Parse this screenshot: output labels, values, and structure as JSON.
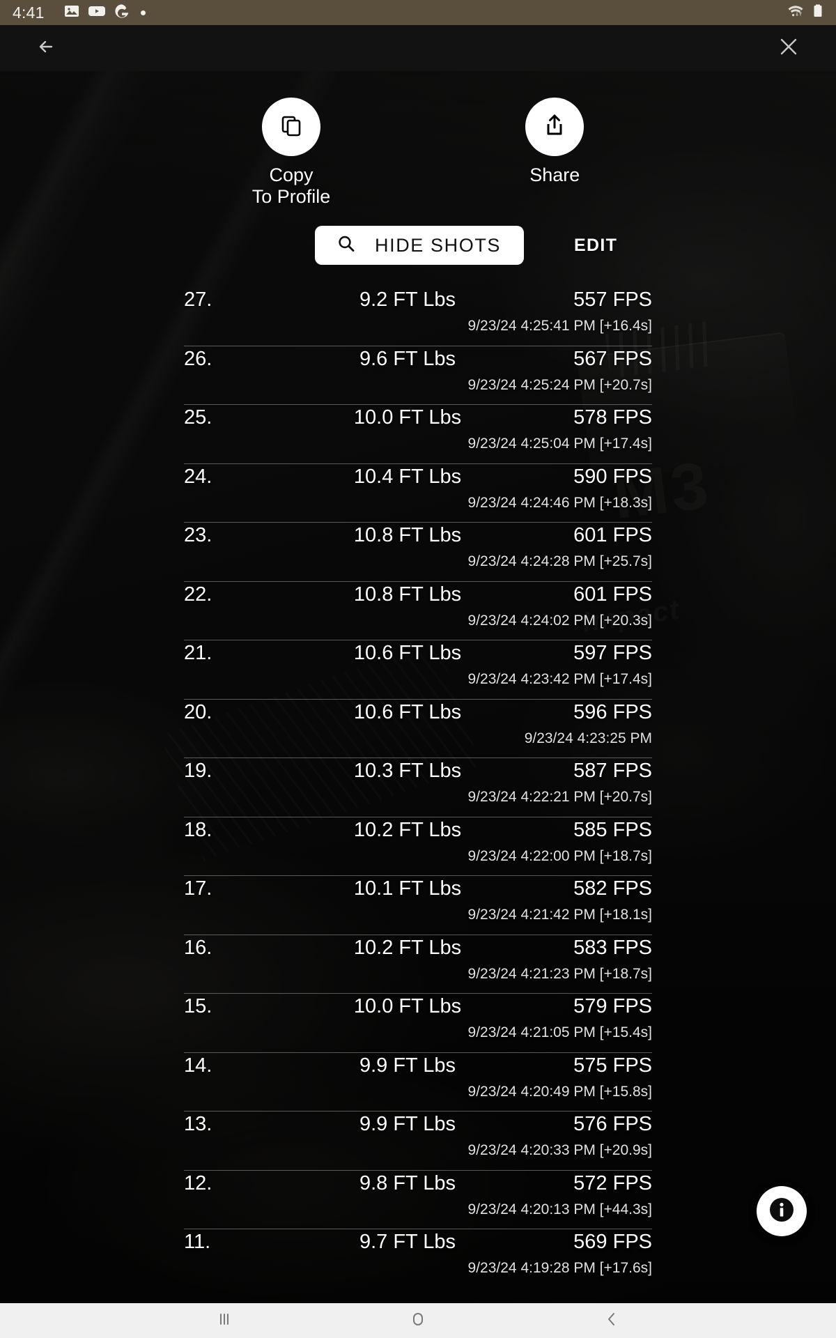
{
  "status_bar": {
    "time": "4:41",
    "icons": [
      "image-icon",
      "youtube-icon",
      "google-icon",
      "dot-icon"
    ],
    "right_icons": [
      "wifi-icon",
      "battery-icon"
    ]
  },
  "app_bar": {
    "back_icon": "arrow-left-icon",
    "close_icon": "close-icon"
  },
  "actions": [
    {
      "icon": "copy-icon",
      "label": "Copy\nTo Profile"
    },
    {
      "icon": "share-icon",
      "label": "Share"
    }
  ],
  "filter_row": {
    "search_icon": "search-icon",
    "hide_shots_label": "HIDE SHOTS",
    "edit_label": "EDIT"
  },
  "shots": [
    {
      "index": "27.",
      "energy": "9.2 FT Lbs",
      "speed": "557 FPS",
      "timestamp": "9/23/24 4:25:41 PM [+16.4s]"
    },
    {
      "index": "26.",
      "energy": "9.6 FT Lbs",
      "speed": "567 FPS",
      "timestamp": "9/23/24 4:25:24 PM [+20.7s]"
    },
    {
      "index": "25.",
      "energy": "10.0 FT Lbs",
      "speed": "578 FPS",
      "timestamp": "9/23/24 4:25:04 PM [+17.4s]"
    },
    {
      "index": "24.",
      "energy": "10.4 FT Lbs",
      "speed": "590 FPS",
      "timestamp": "9/23/24 4:24:46 PM [+18.3s]"
    },
    {
      "index": "23.",
      "energy": "10.8 FT Lbs",
      "speed": "601 FPS",
      "timestamp": "9/23/24 4:24:28 PM [+25.7s]"
    },
    {
      "index": "22.",
      "energy": "10.8 FT Lbs",
      "speed": "601 FPS",
      "timestamp": "9/23/24 4:24:02 PM [+20.3s]"
    },
    {
      "index": "21.",
      "energy": "10.6 FT Lbs",
      "speed": "597 FPS",
      "timestamp": "9/23/24 4:23:42 PM [+17.4s]"
    },
    {
      "index": "20.",
      "energy": "10.6 FT Lbs",
      "speed": "596 FPS",
      "timestamp": "9/23/24 4:23:25 PM"
    },
    {
      "index": "19.",
      "energy": "10.3 FT Lbs",
      "speed": "587 FPS",
      "timestamp": "9/23/24 4:22:21 PM [+20.7s]"
    },
    {
      "index": "18.",
      "energy": "10.2 FT Lbs",
      "speed": "585 FPS",
      "timestamp": "9/23/24 4:22:00 PM [+18.7s]"
    },
    {
      "index": "17.",
      "energy": "10.1 FT Lbs",
      "speed": "582 FPS",
      "timestamp": "9/23/24 4:21:42 PM [+18.1s]"
    },
    {
      "index": "16.",
      "energy": "10.2 FT Lbs",
      "speed": "583 FPS",
      "timestamp": "9/23/24 4:21:23 PM [+18.7s]"
    },
    {
      "index": "15.",
      "energy": "10.0 FT Lbs",
      "speed": "579 FPS",
      "timestamp": "9/23/24 4:21:05 PM [+15.4s]"
    },
    {
      "index": "14.",
      "energy": "9.9 FT Lbs",
      "speed": "575 FPS",
      "timestamp": "9/23/24 4:20:49 PM [+15.8s]"
    },
    {
      "index": "13.",
      "energy": "9.9 FT Lbs",
      "speed": "576 FPS",
      "timestamp": "9/23/24 4:20:33 PM [+20.9s]"
    },
    {
      "index": "12.",
      "energy": "9.8 FT Lbs",
      "speed": "572 FPS",
      "timestamp": "9/23/24 4:20:13 PM [+44.3s]"
    },
    {
      "index": "11.",
      "energy": "9.7 FT Lbs",
      "speed": "569 FPS",
      "timestamp": "9/23/24 4:19:28 PM [+17.6s]"
    }
  ],
  "fab": {
    "icon": "info-icon"
  },
  "nav_bar": {
    "recents_icon": "recents-icon",
    "home_icon": "home-icon",
    "back_icon": "back-chevron-icon"
  },
  "colors": {
    "status_bar_bg": "#594f3c",
    "app_bar_bg": "#121212",
    "nav_bar_bg": "#f0f0f0",
    "accent_white": "#ffffff"
  }
}
